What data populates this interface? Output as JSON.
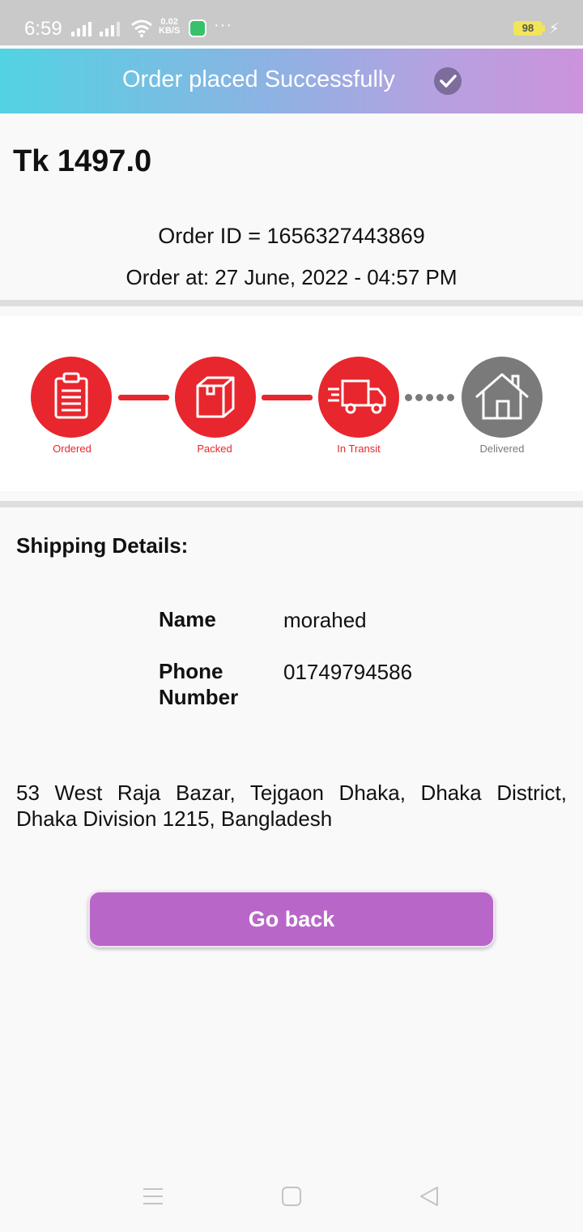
{
  "status_bar": {
    "time": "6:59",
    "net_speed_value": "0.02",
    "net_speed_unit": "KB/S",
    "more": "···",
    "battery": "98"
  },
  "banner": {
    "text": "Order placed Successfully",
    "gradient_start": "#52d3e3",
    "gradient_end": "#cc93dc"
  },
  "order": {
    "total": "Tk 1497.0",
    "id_line": "Order ID = 1656327443869",
    "time_line": "Order at: 27 June, 2022 - 04:57 PM"
  },
  "tracker": {
    "active_color": "#e8262d",
    "inactive_color": "#7a7a7a",
    "steps": [
      {
        "label": "Ordered",
        "icon": "clipboard-icon",
        "done": true
      },
      {
        "label": "Packed",
        "icon": "box-icon",
        "done": true
      },
      {
        "label": "In Transit",
        "icon": "truck-icon",
        "done": true
      },
      {
        "label": "Delivered",
        "icon": "house-icon",
        "done": false
      }
    ]
  },
  "shipping": {
    "title": "Shipping Details:",
    "name_label": "Name",
    "name_value": "morahed",
    "phone_label": "Phone Number",
    "phone_value": "01749794586",
    "address": "53 West Raja Bazar, Tejgaon Dhaka, Dhaka District, Dhaka Division 1215, Bangladesh"
  },
  "actions": {
    "go_back_label": "Go back",
    "button_color": "#b866c8"
  },
  "nav_bar": {
    "icons": [
      "menu-icon",
      "home-square-icon",
      "back-triangle-icon"
    ]
  }
}
